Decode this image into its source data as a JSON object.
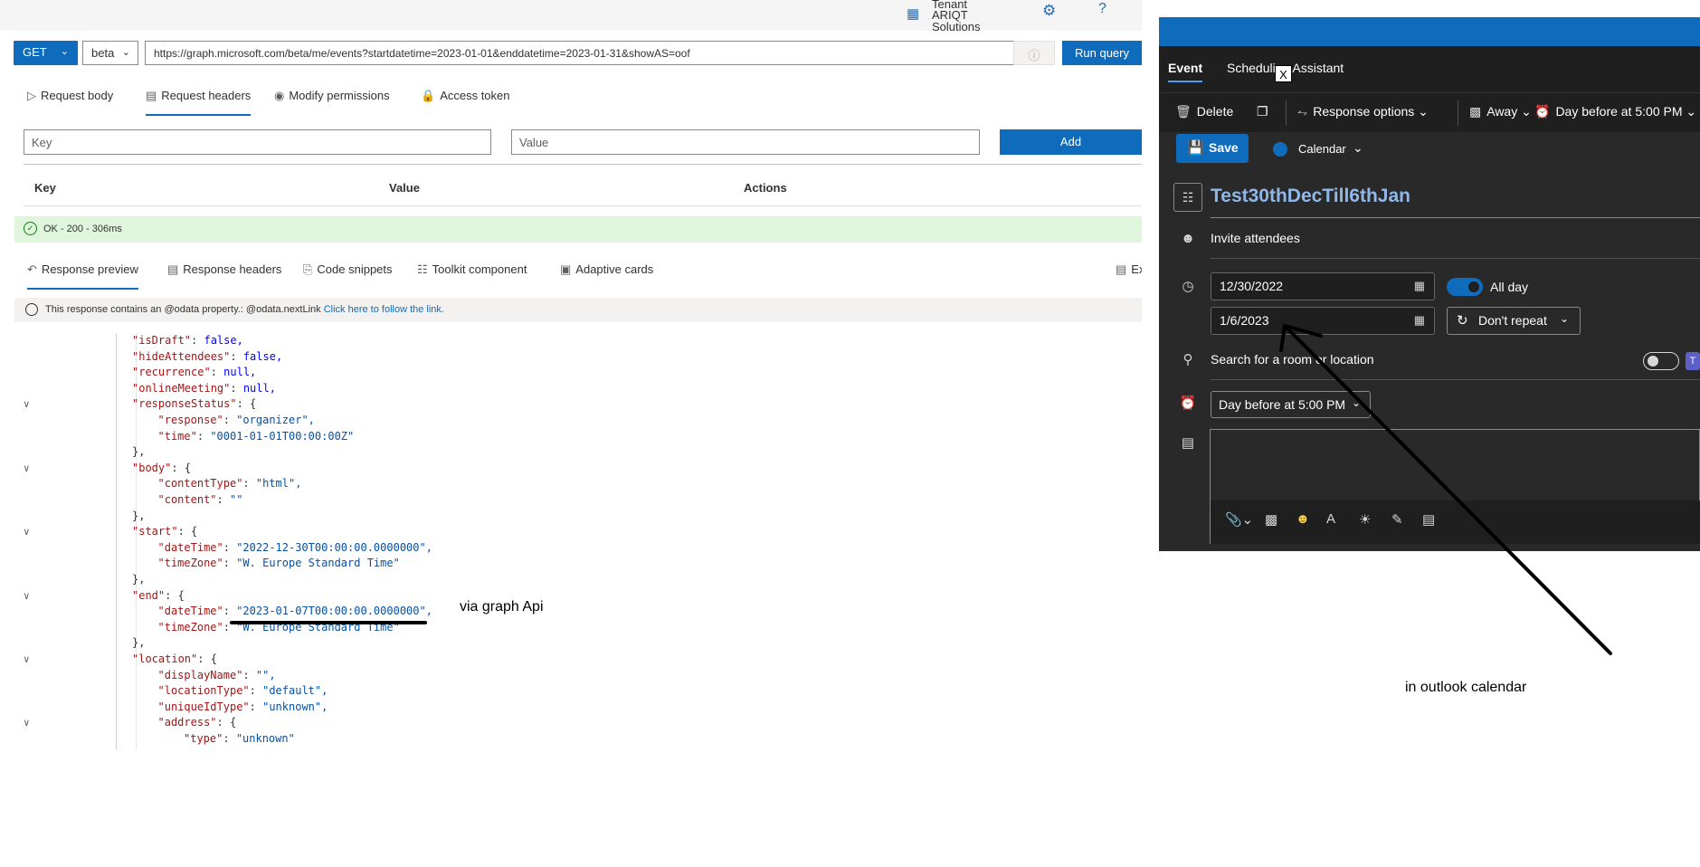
{
  "graph_explorer": {
    "tenant_label": "Tenant",
    "tenant_name": "ARIQT Solutions",
    "method": "GET",
    "version": "beta",
    "url": "https://graph.microsoft.com/beta/me/events?startdatetime=2023-01-01&enddatetime=2023-01-31&showAS=oof",
    "run_label": "Run query",
    "request_tabs": [
      "Request body",
      "Request headers",
      "Modify permissions",
      "Access token"
    ],
    "key_placeholder": "Key",
    "value_placeholder": "Value",
    "add_label": "Add",
    "table_headers": [
      "Key",
      "Value",
      "Actions"
    ],
    "status": "OK - 200 - 306ms",
    "response_tabs": [
      "Response preview",
      "Response headers",
      "Code snippets",
      "Toolkit component",
      "Adaptive cards",
      "Ex"
    ],
    "note_text": "This response contains an @odata property.: @odata.nextLink ",
    "note_link": "Click here to follow the link."
  },
  "code_lines": [
    {
      "fold": false,
      "indent": 4,
      "key": "isDraft",
      "val": "false,",
      "type": "b"
    },
    {
      "fold": false,
      "indent": 4,
      "key": "hideAttendees",
      "val": "false,",
      "type": "b"
    },
    {
      "fold": false,
      "indent": 4,
      "key": "recurrence",
      "val": "null,",
      "type": "b"
    },
    {
      "fold": false,
      "indent": 4,
      "key": "onlineMeeting",
      "val": "null,",
      "type": "b"
    },
    {
      "fold": true,
      "indent": 4,
      "key": "responseStatus",
      "val": "{",
      "type": "p"
    },
    {
      "fold": false,
      "indent": 5,
      "key": "response",
      "val": "\"organizer\",",
      "type": "s"
    },
    {
      "fold": false,
      "indent": 5,
      "key": "time",
      "val": "\"0001-01-01T00:00:00Z\"",
      "type": "s"
    },
    {
      "fold": false,
      "indent": 4,
      "key": "",
      "val": "},",
      "type": "p"
    },
    {
      "fold": true,
      "indent": 4,
      "key": "body",
      "val": "{",
      "type": "p"
    },
    {
      "fold": false,
      "indent": 5,
      "key": "contentType",
      "val": "\"html\",",
      "type": "s"
    },
    {
      "fold": false,
      "indent": 5,
      "key": "content",
      "val": "\"\"",
      "type": "s"
    },
    {
      "fold": false,
      "indent": 4,
      "key": "",
      "val": "},",
      "type": "p"
    },
    {
      "fold": true,
      "indent": 4,
      "key": "start",
      "val": "{",
      "type": "p"
    },
    {
      "fold": false,
      "indent": 5,
      "key": "dateTime",
      "val": "\"2022-12-30T00:00:00.0000000\",",
      "type": "s"
    },
    {
      "fold": false,
      "indent": 5,
      "key": "timeZone",
      "val": "\"W. Europe Standard Time\"",
      "type": "s"
    },
    {
      "fold": false,
      "indent": 4,
      "key": "",
      "val": "},",
      "type": "p"
    },
    {
      "fold": true,
      "indent": 4,
      "key": "end",
      "val": "{",
      "type": "p"
    },
    {
      "fold": false,
      "indent": 5,
      "key": "dateTime",
      "val": "\"2023-01-07T00:00:00.0000000\",",
      "type": "s"
    },
    {
      "fold": false,
      "indent": 5,
      "key": "timeZone",
      "val": "\"W. Europe Standard Time\"",
      "type": "s"
    },
    {
      "fold": false,
      "indent": 4,
      "key": "",
      "val": "},",
      "type": "p"
    },
    {
      "fold": true,
      "indent": 4,
      "key": "location",
      "val": "{",
      "type": "p"
    },
    {
      "fold": false,
      "indent": 5,
      "key": "displayName",
      "val": "\"\",",
      "type": "s"
    },
    {
      "fold": false,
      "indent": 5,
      "key": "locationType",
      "val": "\"default\",",
      "type": "s"
    },
    {
      "fold": false,
      "indent": 5,
      "key": "uniqueIdType",
      "val": "\"unknown\",",
      "type": "s"
    },
    {
      "fold": true,
      "indent": 5,
      "key": "address",
      "val": "{",
      "type": "p"
    },
    {
      "fold": false,
      "indent": 6,
      "key": "type",
      "val": "\"unknown\"",
      "type": "s"
    }
  ],
  "outlook": {
    "tabs": [
      "Event",
      "Scheduling Assistant"
    ],
    "close_x": "X",
    "toolbar": {
      "delete": "Delete",
      "response_options": "Response options",
      "show_as": "Away",
      "reminder": "Day before at 5:00 PM"
    },
    "save_label": "Save",
    "calendar_label": "Calendar",
    "title": "Test30thDecTill6thJan",
    "invite": "Invite attendees",
    "start_date": "12/30/2022",
    "end_date": "1/6/2023",
    "all_day": "All day",
    "repeat": "Don't repeat",
    "location": "Search for a room or location",
    "reminder": "Day before at 5:00 PM",
    "accent": "#0f6cbd"
  },
  "annotations": {
    "graph": "via graph Api",
    "outlook": "in outlook calendar"
  }
}
